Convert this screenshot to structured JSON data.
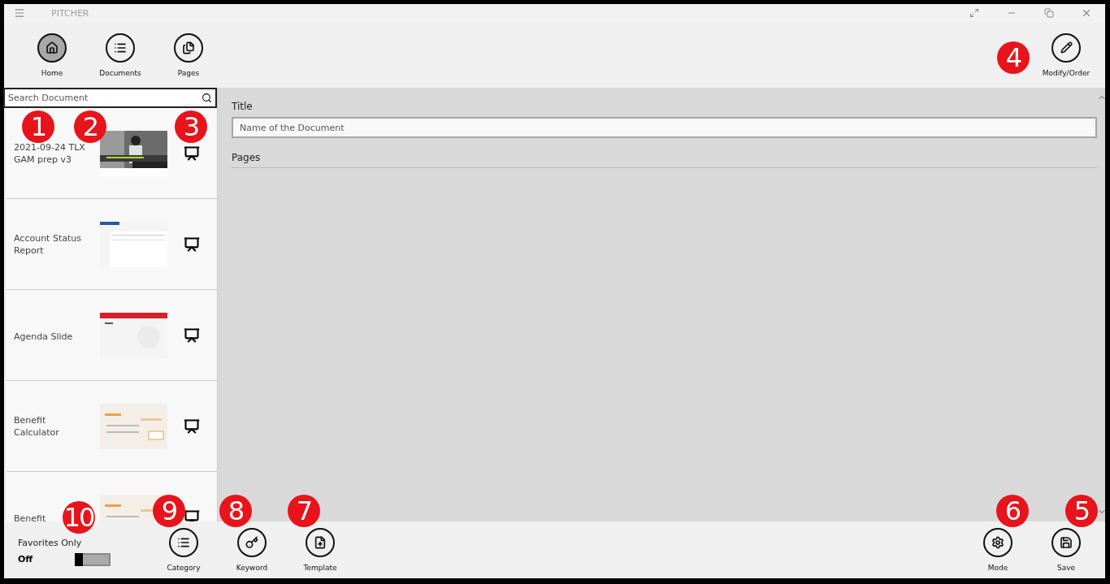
{
  "app_title": "PITCHER",
  "toolbar": [
    {
      "kind": "home",
      "label": "Home",
      "selected": true
    },
    {
      "kind": "documents",
      "label": "Documents",
      "selected": false
    },
    {
      "kind": "pages",
      "label": "Pages",
      "selected": false
    }
  ],
  "modify_button": {
    "label": "Modify/Order"
  },
  "search": {
    "placeholder": "Search Document"
  },
  "documents": [
    {
      "title": "2021-09-24 TLX GAM prep v3"
    },
    {
      "title": "Account Status Report"
    },
    {
      "title": "Agenda Slide"
    },
    {
      "title": "Benefit Calculator"
    },
    {
      "title": "Benefit"
    }
  ],
  "form": {
    "title_label": "Title",
    "title_placeholder": "Name of the Document",
    "pages_label": "Pages"
  },
  "favorites": {
    "label": "Favorites Only",
    "state": "Off",
    "on": false
  },
  "bottom_actions": [
    {
      "kind": "category",
      "label": "Category"
    },
    {
      "kind": "keyword",
      "label": "Keyword"
    },
    {
      "kind": "template",
      "label": "Template"
    }
  ],
  "right_actions": [
    {
      "kind": "mode",
      "label": "Mode"
    },
    {
      "kind": "save",
      "label": "Save"
    }
  ],
  "callouts": [
    {
      "number": "1"
    },
    {
      "number": "2"
    },
    {
      "number": "3"
    },
    {
      "number": "4"
    },
    {
      "number": "10"
    },
    {
      "number": "9"
    },
    {
      "number": "8"
    },
    {
      "number": "7"
    },
    {
      "number": "6"
    },
    {
      "number": "5"
    }
  ]
}
